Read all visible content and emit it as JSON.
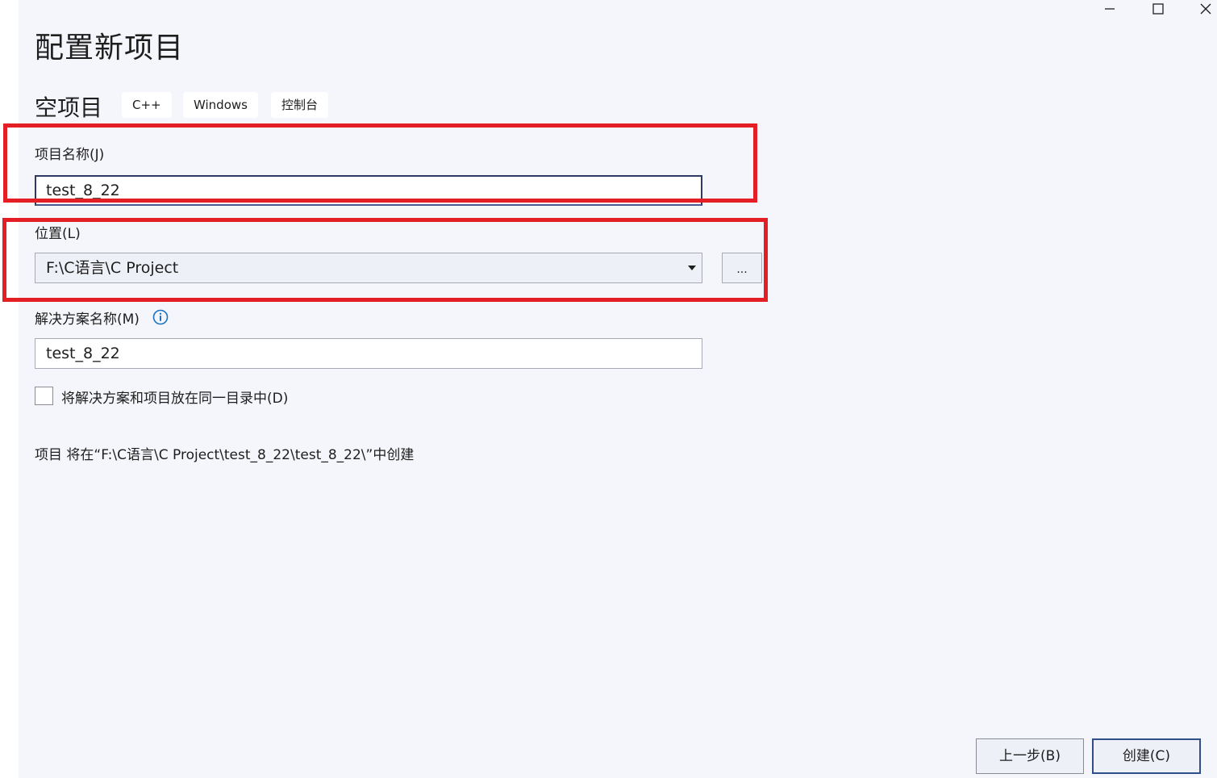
{
  "window": {
    "title": "配置新项目",
    "controls": {
      "minimize": "minimize-icon",
      "maximize": "maximize-icon",
      "close": "close-icon"
    }
  },
  "template": {
    "name": "空项目",
    "tags": [
      "C++",
      "Windows",
      "控制台"
    ]
  },
  "project_name": {
    "label": "项目名称(J)",
    "value": "test_8_22"
  },
  "location": {
    "label": "位置(L)",
    "value": "F:\\C语言\\C Project",
    "browse_label": "..."
  },
  "solution_name": {
    "label": "解决方案名称(M)",
    "value": "test_8_22",
    "info_icon": "info-icon"
  },
  "same_directory": {
    "label": "将解决方案和项目放在同一目录中(D)",
    "checked": false
  },
  "summary": "项目 将在“F:\\C语言\\C Project\\test_8_22\\test_8_22\\”中创建",
  "footer": {
    "back_label": "上一步(B)",
    "create_label": "创建(C)"
  },
  "colors": {
    "background": "#f5f6fb",
    "highlight": "#e31e24",
    "accent": "#2e4f8a",
    "info": "#1a73c0"
  }
}
